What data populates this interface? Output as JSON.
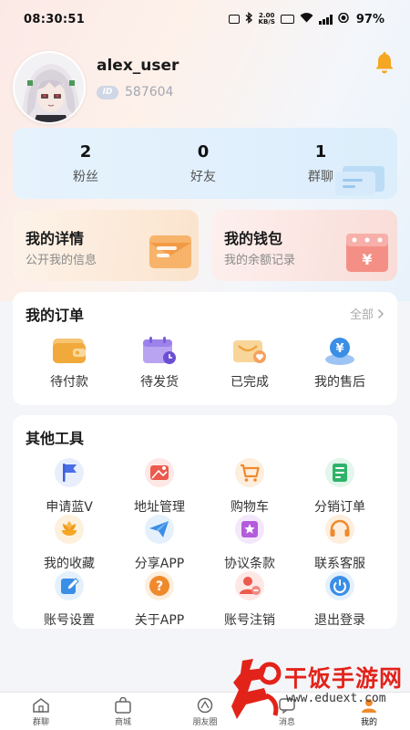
{
  "status_bar": {
    "time": "08:30:51",
    "net_speed_top": "2.00",
    "net_speed_bottom": "KB/S",
    "battery": "97%"
  },
  "profile": {
    "username": "alex_user",
    "id_badge": "ID",
    "id_value": "587604"
  },
  "stats": [
    {
      "value": "2",
      "label": "粉丝"
    },
    {
      "value": "0",
      "label": "好友"
    },
    {
      "value": "1",
      "label": "群聊"
    }
  ],
  "detail_card": {
    "title": "我的详情",
    "subtitle": "公开我的信息"
  },
  "wallet_card": {
    "title": "我的钱包",
    "subtitle": "我的余额记录"
  },
  "orders": {
    "title": "我的订单",
    "see_all": "全部",
    "items": [
      {
        "label": "待付款",
        "icon": "wallet-icon"
      },
      {
        "label": "待发货",
        "icon": "calendar-clock-icon"
      },
      {
        "label": "已完成",
        "icon": "completed-box-icon"
      },
      {
        "label": "我的售后",
        "icon": "yen-service-icon"
      }
    ]
  },
  "tools": {
    "title": "其他工具",
    "items": [
      {
        "label": "申请蓝V",
        "icon": "flag-icon"
      },
      {
        "label": "地址管理",
        "icon": "map-icon"
      },
      {
        "label": "购物车",
        "icon": "cart-icon"
      },
      {
        "label": "分销订单",
        "icon": "document-icon"
      },
      {
        "label": "我的收藏",
        "icon": "flower-icon"
      },
      {
        "label": "分享APP",
        "icon": "paper-plane-icon"
      },
      {
        "label": "协议条款",
        "icon": "agreement-icon"
      },
      {
        "label": "联系客服",
        "icon": "headset-icon"
      },
      {
        "label": "账号设置",
        "icon": "edit-icon"
      },
      {
        "label": "关于APP",
        "icon": "question-icon"
      },
      {
        "label": "账号注销",
        "icon": "user-remove-icon"
      },
      {
        "label": "退出登录",
        "icon": "power-icon"
      }
    ]
  },
  "tab_bar": [
    {
      "label": "群聊",
      "icon": "home-icon"
    },
    {
      "label": "商城",
      "icon": "shop-bag-icon"
    },
    {
      "label": "朋友圈",
      "icon": "moments-icon"
    },
    {
      "label": "消息",
      "icon": "message-icon"
    },
    {
      "label": "我的",
      "icon": "profile-icon",
      "active": true
    }
  ],
  "watermark": {
    "brand": "干饭手游网",
    "url": "www.eduext.com"
  },
  "colors": {
    "accent_orange": "#f5a623",
    "accent_blue": "#3a8ee6",
    "watermark_red": "#e2231a"
  }
}
